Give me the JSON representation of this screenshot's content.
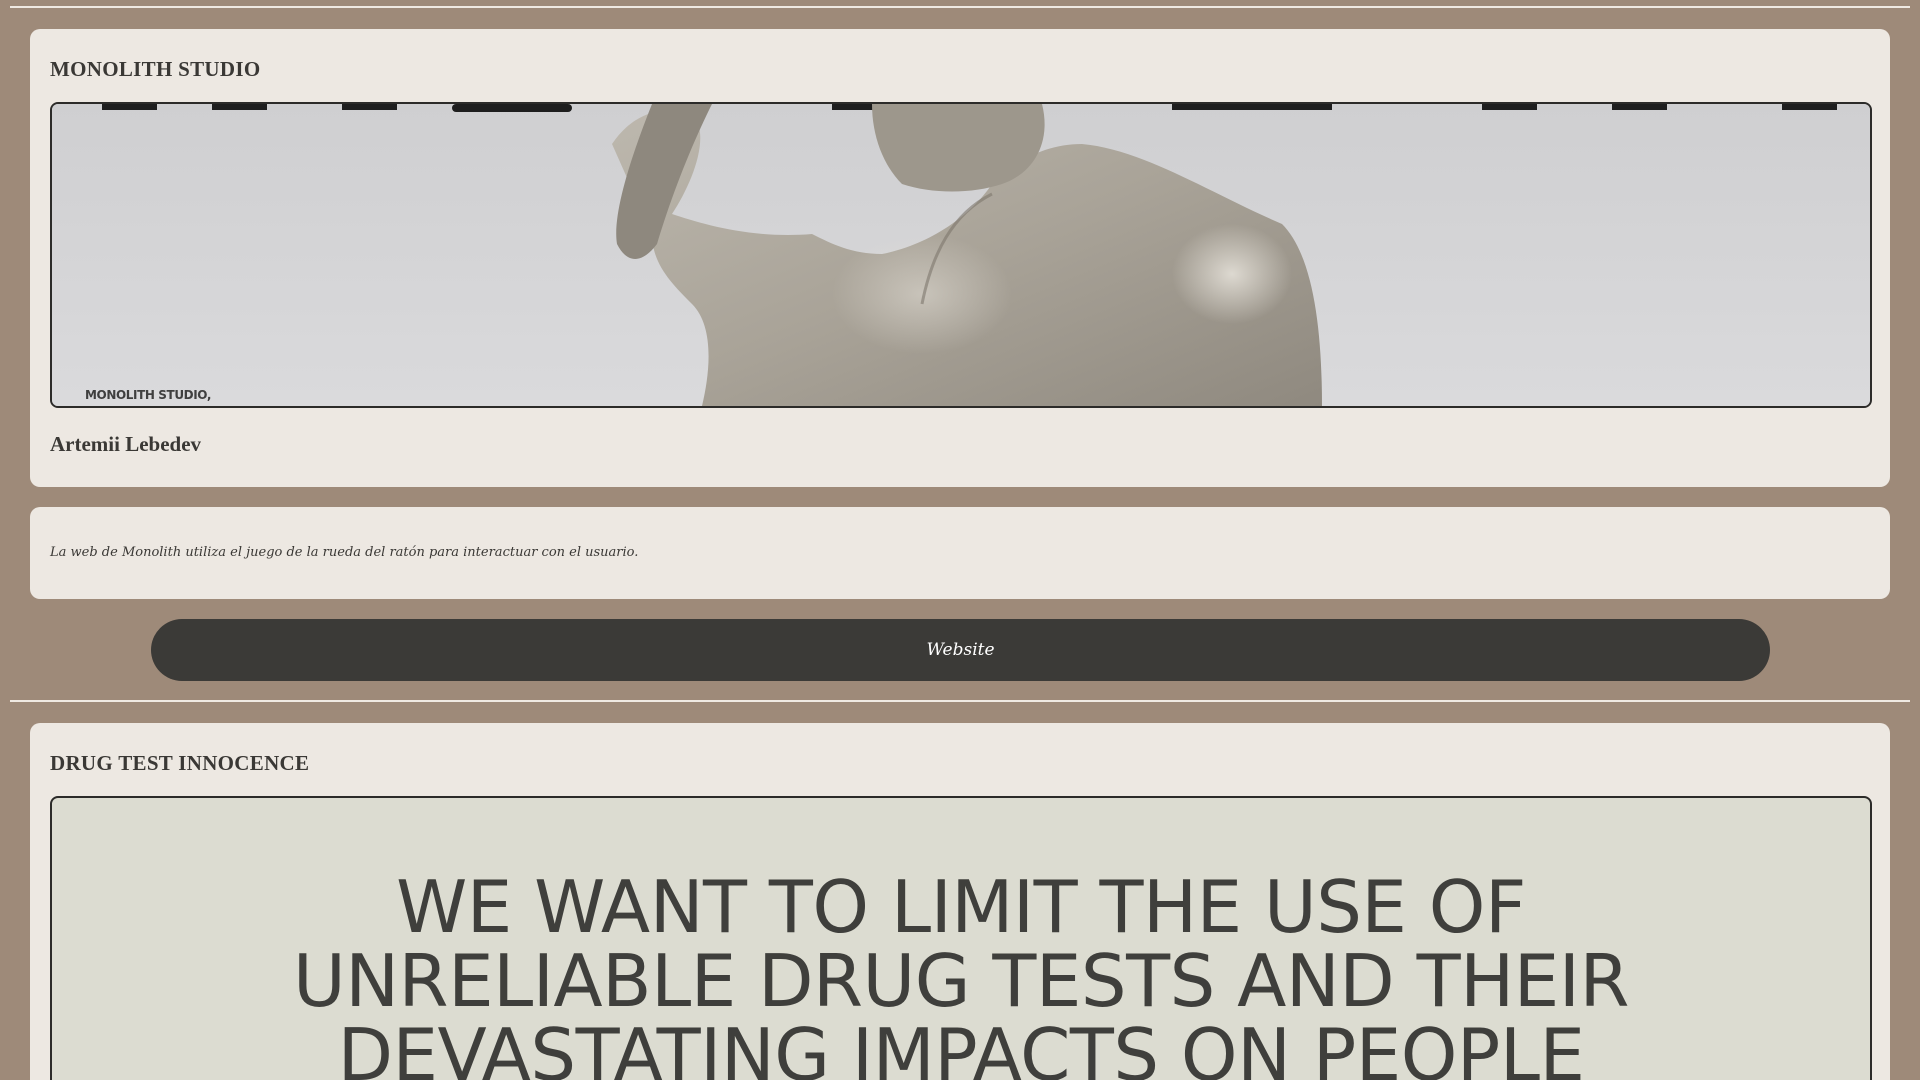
{
  "projects": [
    {
      "title": "MONOLITH STUDIO",
      "author": "Artemii Lebedev",
      "preview_caption": "MONOLITH STUDIO,",
      "description": "La web de Monolith utiliza el juego de la rueda del ratón para interactuar con el usuario.",
      "website_label": "Website"
    },
    {
      "title": "DRUG TEST INNOCENCE",
      "preview_headline": "WE WANT TO LIMIT THE USE OF UNRELIABLE DRUG TESTS AND THEIR DEVASTATING IMPACTS ON PEOPLE"
    }
  ],
  "colors": {
    "background": "#9e8a79",
    "card": "#ede8e2",
    "button": "#3b3a37",
    "text": "#3a3835"
  }
}
